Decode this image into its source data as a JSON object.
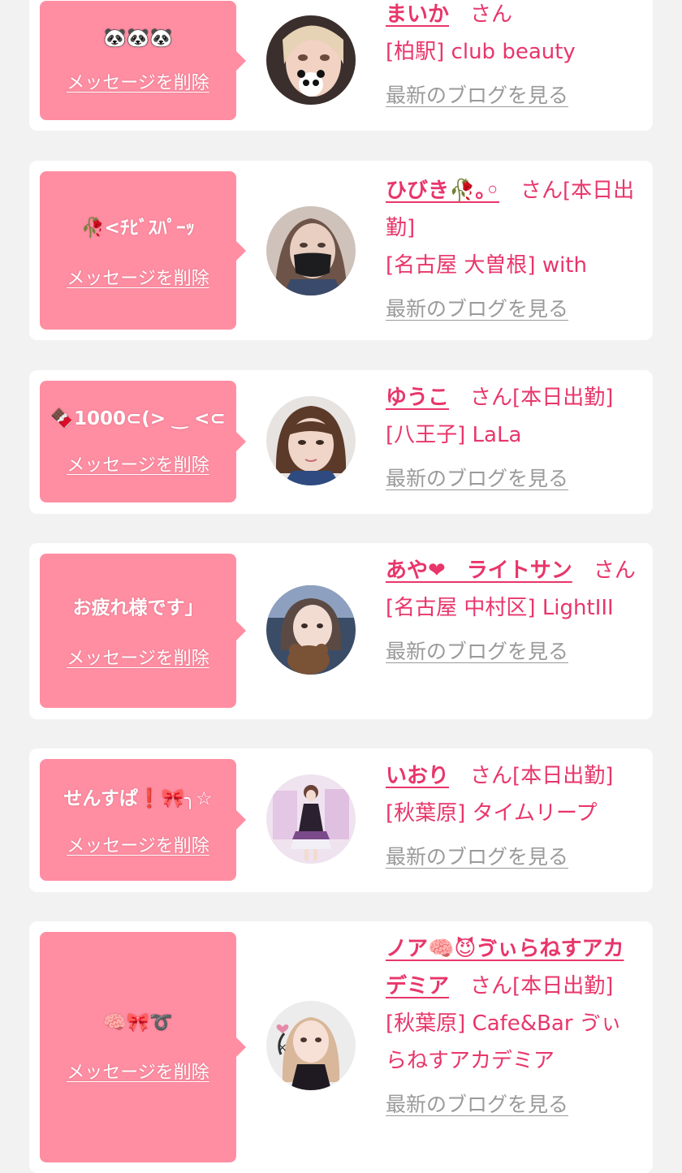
{
  "cards": [
    {
      "message": "🐼🐼🐼",
      "delete_label": "メッセージを削除",
      "name": "まいか",
      "honorific": "さん",
      "status": "",
      "shop": "[柏駅] club beauty",
      "blog_label": "最新のブログを見る"
    },
    {
      "message": "🥀<ﾁﾋﾞｽﾊﾟｰｯ",
      "delete_label": "メッセージを削除",
      "name": "ひびき🥀｡◦",
      "honorific": "さん",
      "status": "[本日出勤]",
      "shop": "[名古屋 大曽根] with",
      "blog_label": "最新のブログを見る"
    },
    {
      "message": "🍫1000⊂(> ‿ <⊂",
      "delete_label": "メッセージを削除",
      "name": "ゆうこ",
      "honorific": "さん",
      "status": "[本日出勤]",
      "shop": "[八王子] LaLa",
      "blog_label": "最新のブログを見る"
    },
    {
      "message": "お疲れ様です」",
      "delete_label": "メッセージを削除",
      "name": "あや❤︎　ライトサン",
      "honorific": "さん",
      "status": "",
      "shop": "[名古屋 中村区] LightIII",
      "blog_label": "最新のブログを見る"
    },
    {
      "message": "せんすぱ❗️🎀╮☆",
      "delete_label": "メッセージを削除",
      "name": "いおり",
      "honorific": "さん",
      "status": "[本日出勤]",
      "shop": "[秋葉原] タイムリープ",
      "blog_label": "最新のブログを見る"
    },
    {
      "message": "🧠🎀➰",
      "delete_label": "メッセージを削除",
      "name": "ノア🧠😈ゔぃらねすアカデミア",
      "honorific": "さん",
      "status": "[本日出勤]",
      "shop": "[秋葉原] Cafe&Bar ゔぃらねすアカデミア",
      "blog_label": "最新のブログを見る"
    }
  ],
  "colors": {
    "accent": "#e8366a",
    "bubble": "#ff8ea3",
    "muted": "#9a9a9a",
    "background": "#f2f2f2"
  }
}
